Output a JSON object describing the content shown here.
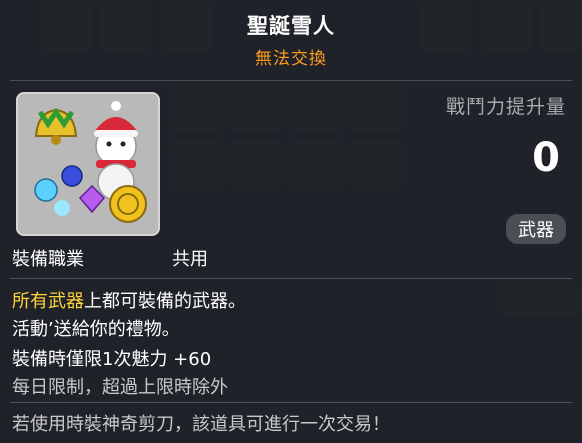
{
  "item": {
    "name": "聖誕雪人",
    "trade_status": "無法交換",
    "power_label": "戰鬥力提升量",
    "power_value": "0",
    "category": "武器",
    "job_label": "裝備職業",
    "job_value": "共用"
  },
  "description": {
    "line1_highlight": "所有武器",
    "line1_rest": "上都可裝備的武器。",
    "line2": "活動’送給你的禮物。",
    "line3": "裝備時僅限1次魅力  +60",
    "line4": "每日限制，超過上限時除外",
    "line5": "若使用時裝神奇剪刀，該道具可進行一次交易！"
  },
  "icon_names": [
    "bell-icon",
    "snowman-icon",
    "gold-coin-icon",
    "gem-icon"
  ],
  "colors": {
    "title": "#ffffff",
    "trade_status": "#ff9a1f",
    "highlight": "#ffd33a",
    "background": "#2a2e33"
  }
}
